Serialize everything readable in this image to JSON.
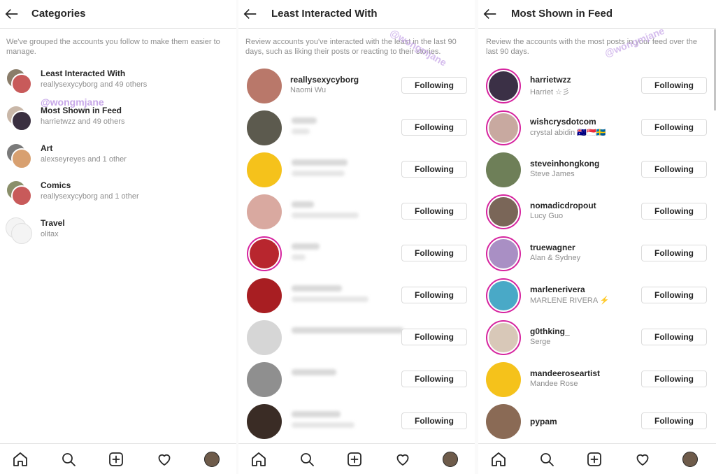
{
  "categories_panel": {
    "title": "Categories",
    "description": "We've grouped the accounts you follow to make them easier to manage.",
    "watermark": "@wongmjane",
    "items": [
      {
        "name": "Least Interacted With",
        "subtitle": "reallysexycyborg and 49 others",
        "color_a": "#8a7d6a",
        "color_b": "#c85a5a"
      },
      {
        "name": "Most Shown in Feed",
        "subtitle": "harrietwzz and 49 others",
        "color_a": "#c9b7a8",
        "color_b": "#3a2f40"
      },
      {
        "name": "Art",
        "subtitle": "alexseyreyes and 1 other",
        "color_a": "#7a7a7a",
        "color_b": "#d8a070"
      },
      {
        "name": "Comics",
        "subtitle": "reallysexycyborg and 1 other",
        "color_a": "#8a8f6a",
        "color_b": "#c85a5a"
      },
      {
        "name": "Travel",
        "subtitle": "olitax",
        "color_a": "#f4f4f4",
        "color_b": "#f4f4f4"
      }
    ]
  },
  "least_panel": {
    "title": "Least Interacted With",
    "description": "Review accounts you've interacted with the least in the last 90 days, such as liking their posts or reacting to their stories.",
    "watermark": "@wongmjane",
    "rows": [
      {
        "username": "reallysexycyborg",
        "fullname": "Naomi Wu",
        "button": "Following",
        "color": "#b9786a",
        "ring": false,
        "blurred": false,
        "w1": 0,
        "w2": 0
      },
      {
        "username": "",
        "fullname": "",
        "button": "Following",
        "color": "#5c5a4e",
        "ring": false,
        "blurred": true,
        "w1": 36,
        "w2": 26
      },
      {
        "username": "",
        "fullname": "",
        "button": "Following",
        "color": "#f5c21b",
        "ring": false,
        "blurred": true,
        "w1": 80,
        "w2": 76
      },
      {
        "username": "",
        "fullname": "",
        "button": "Following",
        "color": "#d9a9a0",
        "ring": false,
        "blurred": true,
        "w1": 32,
        "w2": 96
      },
      {
        "username": "",
        "fullname": "",
        "button": "Following",
        "color": "#b8262e",
        "ring": true,
        "blurred": true,
        "w1": 40,
        "w2": 20
      },
      {
        "username": "",
        "fullname": "",
        "button": "Following",
        "color": "#a81e22",
        "ring": false,
        "blurred": true,
        "w1": 72,
        "w2": 110
      },
      {
        "username": "",
        "fullname": "",
        "button": "Following",
        "color": "#d6d6d6",
        "ring": false,
        "blurred": true,
        "w1": 160,
        "w2": 0
      },
      {
        "username": "",
        "fullname": "",
        "button": "Following",
        "color": "#8f8f8f",
        "ring": false,
        "blurred": true,
        "w1": 64,
        "w2": 0
      },
      {
        "username": "",
        "fullname": "",
        "button": "Following",
        "color": "#3a2c25",
        "ring": false,
        "blurred": true,
        "w1": 70,
        "w2": 90
      }
    ]
  },
  "feed_panel": {
    "title": "Most Shown in Feed",
    "description": "Review the accounts with the most posts in your feed over the last 90 days.",
    "watermark": "@wongmjane",
    "rows": [
      {
        "username": "harrietwzz",
        "fullname": "Harriet ☆彡",
        "button": "Following",
        "color": "#3b3046",
        "ring": true
      },
      {
        "username": "wishcrysdotcom",
        "fullname": "crystal abidin 🇦🇺🇸🇬🇸🇪",
        "button": "Following",
        "color": "#c8a9a0",
        "ring": true
      },
      {
        "username": "steveinhongkong",
        "fullname": "Steve James",
        "button": "Following",
        "color": "#6e7f58",
        "ring": false
      },
      {
        "username": "nomadicdropout",
        "fullname": "Lucy Guo",
        "button": "Following",
        "color": "#7a6658",
        "ring": true
      },
      {
        "username": "truewagner",
        "fullname": "Alan & Sydney",
        "button": "Following",
        "color": "#a98fc4",
        "ring": true
      },
      {
        "username": "marlenerivera",
        "fullname": "MARLENE RIVERA ⚡",
        "button": "Following",
        "color": "#49a9c7",
        "ring": true
      },
      {
        "username": "g0thking_",
        "fullname": "Serge",
        "button": "Following",
        "color": "#d8c8b8",
        "ring": true
      },
      {
        "username": "mandeeroseartist",
        "fullname": "Mandee Rose",
        "button": "Following",
        "color": "#f5c21b",
        "ring": false
      },
      {
        "username": "pypam",
        "fullname": "",
        "button": "Following",
        "color": "#8a6a55",
        "ring": false
      }
    ]
  },
  "nav": {
    "icons": [
      "home-icon",
      "search-icon",
      "new-post-icon",
      "activity-heart-icon",
      "profile-avatar"
    ],
    "text_color": "#262626"
  }
}
